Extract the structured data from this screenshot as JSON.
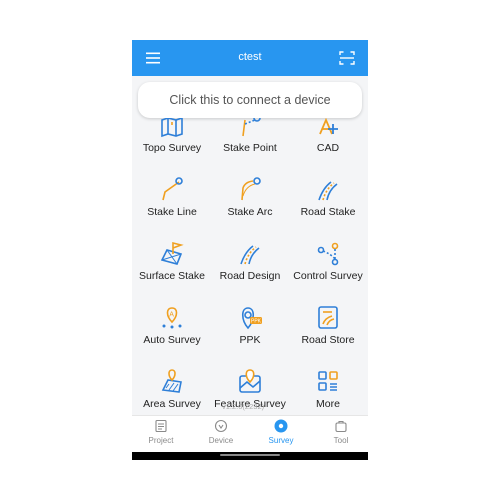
{
  "header": {
    "title": "ctest",
    "menu_icon": "menu-icon",
    "scan_icon": "scan-icon"
  },
  "connect_prompt": "Click this to connect a device",
  "colors": {
    "primary": "#2896f0",
    "icon_orange": "#f0a020",
    "icon_blue": "#2e7fd8"
  },
  "grid": {
    "items": [
      {
        "label": "Topo Survey",
        "icon": "topo-survey-icon"
      },
      {
        "label": "Stake Point",
        "icon": "stake-point-icon"
      },
      {
        "label": "CAD",
        "icon": "cad-icon"
      },
      {
        "label": "Stake Line",
        "icon": "stake-line-icon"
      },
      {
        "label": "Stake Arc",
        "icon": "stake-arc-icon"
      },
      {
        "label": "Road Stake",
        "icon": "road-stake-icon"
      },
      {
        "label": "Surface Stake",
        "icon": "surface-stake-icon"
      },
      {
        "label": "Road Design",
        "icon": "road-design-icon"
      },
      {
        "label": "Control Survey",
        "icon": "control-survey-icon"
      },
      {
        "label": "Auto Survey",
        "icon": "auto-survey-icon"
      },
      {
        "label": "PPK",
        "icon": "ppk-icon"
      },
      {
        "label": "Road Store",
        "icon": "road-store-icon"
      },
      {
        "label": "Area Survey",
        "icon": "area-survey-icon"
      },
      {
        "label": "Feature Survey",
        "icon": "feature-survey-icon"
      },
      {
        "label": "More",
        "icon": "more-icon"
      }
    ]
  },
  "version_text": "v1.2.0(2232)",
  "bottom_nav": {
    "items": [
      {
        "label": "Project",
        "icon": "project-icon",
        "active": false
      },
      {
        "label": "Device",
        "icon": "device-icon",
        "active": false
      },
      {
        "label": "Survey",
        "icon": "survey-icon",
        "active": true
      },
      {
        "label": "Tool",
        "icon": "tool-icon",
        "active": false
      }
    ]
  }
}
